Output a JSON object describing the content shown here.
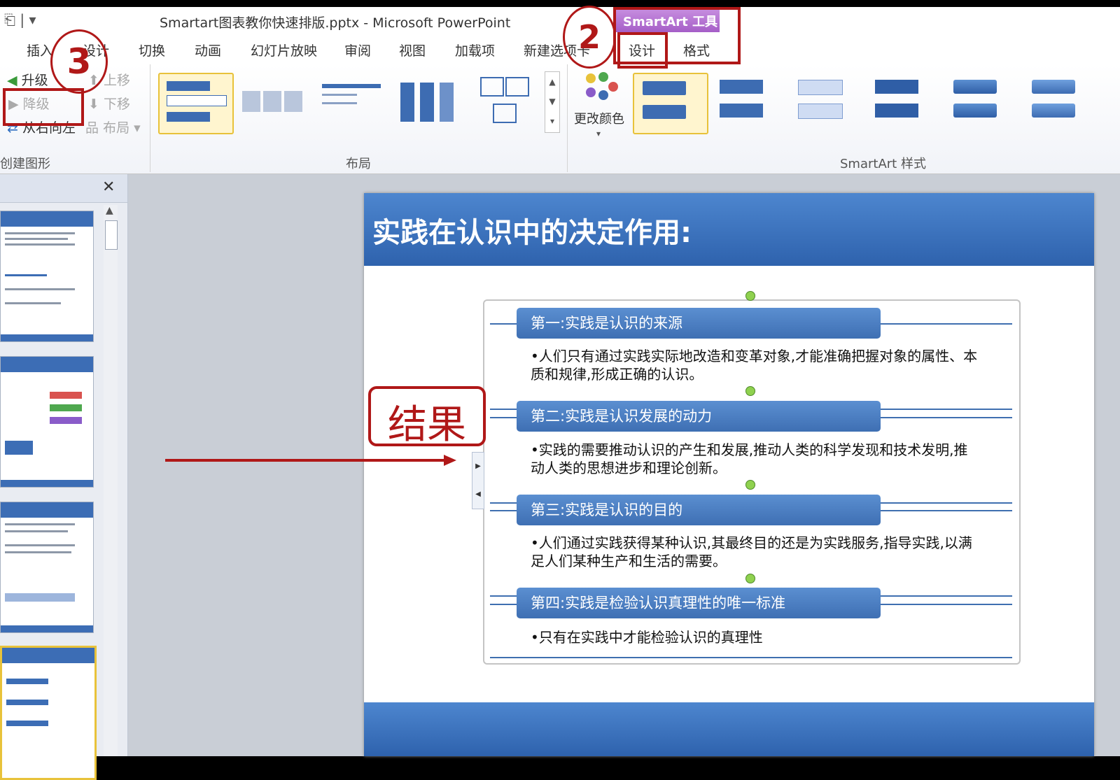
{
  "window": {
    "title": "Smartart图表教你快速排版.pptx - Microsoft PowerPoint"
  },
  "contextual_tab": {
    "label": "SmartArt 工具",
    "tabs": [
      "设计",
      "格式"
    ]
  },
  "ribbon_tabs": [
    "插入",
    "设计",
    "切换",
    "动画",
    "幻灯片放映",
    "审阅",
    "视图",
    "加载项",
    "新建选项卡"
  ],
  "create_graphic": {
    "group_label": "创建图形",
    "promote": "升级",
    "demote": "降级",
    "right_to_left": "从右向左",
    "move_up": "上移",
    "move_down": "下移",
    "layout_btn": "布局"
  },
  "layout_group": {
    "label": "布局"
  },
  "styles_group": {
    "label": "SmartArt 样式",
    "change_colors": "更改颜色"
  },
  "annotations": {
    "step2": "2",
    "step3": "3",
    "result": "结果"
  },
  "slide": {
    "title": "实践在认识中的决定作用:",
    "items": [
      {
        "head": "第一:实践是认识的来源",
        "body": "•人们只有通过实践实际地改造和变革对象,才能准确把握对象的属性、本质和规律,形成正确的认识。"
      },
      {
        "head": "第二:实践是认识发展的动力",
        "body": "•实践的需要推动认识的产生和发展,推动人类的科学发现和技术发明,推动人类的思想进步和理论创新。"
      },
      {
        "head": "第三:实践是认识的目的",
        "body": "•人们通过实践获得某种认识,其最终目的还是为实践服务,指导实践,以满足人们某种生产和生活的需要。"
      },
      {
        "head": "第四:实践是检验认识真理性的唯一标准",
        "body": "•只有在实践中才能检验认识的真理性"
      }
    ]
  }
}
